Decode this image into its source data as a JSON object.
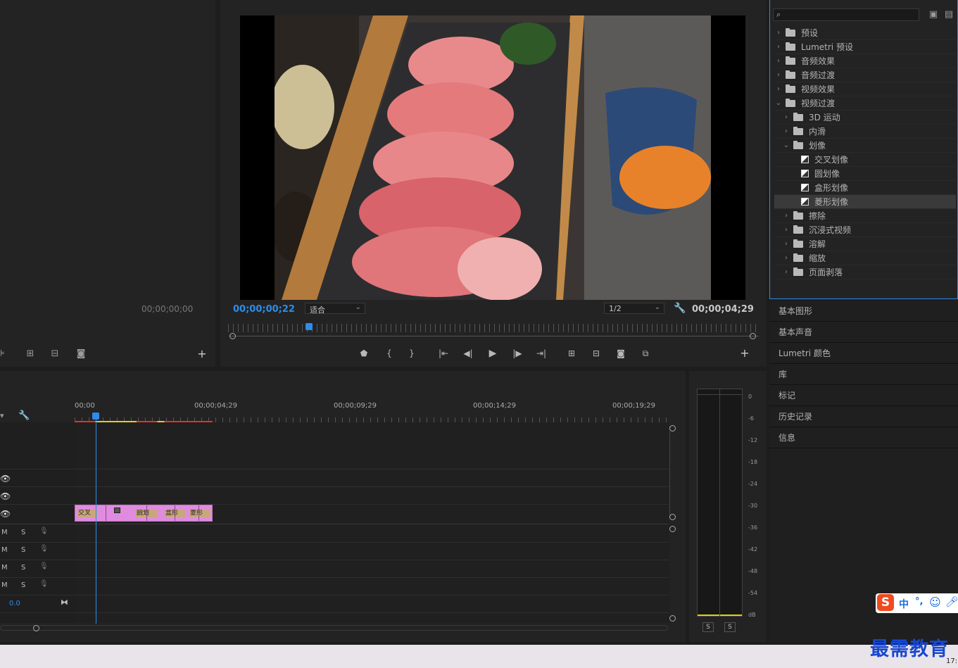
{
  "source_monitor": {
    "timecode": "00;00;00;00"
  },
  "program_monitor": {
    "current_timecode": "00;00;00;22",
    "fit_label": "适合",
    "resolution": "1/2",
    "duration_timecode": "00;00;04;29",
    "playhead_fraction": 0.15
  },
  "effects": {
    "search_placeholder": "",
    "tree": [
      {
        "label": "预设",
        "level": 0,
        "expanded": false,
        "kind": "preset"
      },
      {
        "label": "Lumetri 预设",
        "level": 0,
        "expanded": false,
        "kind": "folder"
      },
      {
        "label": "音频效果",
        "level": 0,
        "expanded": false,
        "kind": "folder"
      },
      {
        "label": "音频过渡",
        "level": 0,
        "expanded": false,
        "kind": "folder"
      },
      {
        "label": "视频效果",
        "level": 0,
        "expanded": false,
        "kind": "folder"
      },
      {
        "label": "视频过渡",
        "level": 0,
        "expanded": true,
        "kind": "folder"
      },
      {
        "label": "3D 运动",
        "level": 1,
        "expanded": false,
        "kind": "folder"
      },
      {
        "label": "内滑",
        "level": 1,
        "expanded": false,
        "kind": "folder"
      },
      {
        "label": "划像",
        "level": 1,
        "expanded": true,
        "kind": "folder"
      },
      {
        "label": "交叉划像",
        "level": 2,
        "kind": "effect"
      },
      {
        "label": "圆划像",
        "level": 2,
        "kind": "effect"
      },
      {
        "label": "盒形划像",
        "level": 2,
        "kind": "effect"
      },
      {
        "label": "菱形划像",
        "level": 2,
        "kind": "effect",
        "selected": true
      },
      {
        "label": "擦除",
        "level": 1,
        "expanded": false,
        "kind": "folder"
      },
      {
        "label": "沉浸式视频",
        "level": 1,
        "expanded": false,
        "kind": "folder"
      },
      {
        "label": "溶解",
        "level": 1,
        "expanded": false,
        "kind": "folder"
      },
      {
        "label": "缩放",
        "level": 1,
        "expanded": false,
        "kind": "folder"
      },
      {
        "label": "页面剥落",
        "level": 1,
        "expanded": false,
        "kind": "folder"
      }
    ]
  },
  "right_panels": [
    "基本图形",
    "基本声音",
    "Lumetri 颜色",
    "库",
    "标记",
    "历史记录",
    "信息"
  ],
  "timeline": {
    "ruler": [
      "00;00",
      "00;00;04;29",
      "00;00;09;29",
      "00;00;14;29",
      "00;00;19;29"
    ],
    "audio_rows": [
      {
        "m": "M",
        "s": "S"
      },
      {
        "m": "M",
        "s": "S"
      },
      {
        "m": "M",
        "s": "S"
      },
      {
        "m": "M",
        "s": "S"
      }
    ],
    "master_volume": "0.0",
    "clip_labels": [
      "交叉",
      "圆划",
      "盒形",
      "菱形"
    ]
  },
  "meter": {
    "scale": [
      "0",
      "-6",
      "-12",
      "-18",
      "-24",
      "-30",
      "-36",
      "-42",
      "-48",
      "-54",
      "dB"
    ],
    "solo_left": "S",
    "solo_right": "S"
  },
  "ime": {
    "lang": "中",
    "punct": "°,"
  },
  "watermark": "最需教育",
  "taskbar_clock": "17:"
}
